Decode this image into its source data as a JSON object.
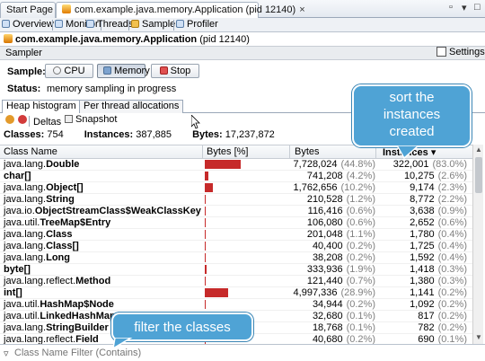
{
  "doc_tabs": [
    {
      "label": "Start Page",
      "active": false
    },
    {
      "label": "com.example.java.memory.Application (pid 12140)",
      "active": true
    }
  ],
  "sub_tabs": [
    {
      "label": "Overview",
      "icon": "overview-icon"
    },
    {
      "label": "Monitor",
      "icon": "monitor-icon"
    },
    {
      "label": "Threads",
      "icon": "threads-icon"
    },
    {
      "label": "Sampler",
      "icon": "sampler-icon",
      "active": true
    },
    {
      "label": "Profiler",
      "icon": "profiler-icon"
    }
  ],
  "app": {
    "name": "com.example.java.memory.Application",
    "pid": "(pid 12140)"
  },
  "section": {
    "title": "Sampler",
    "settings_label": "Settings"
  },
  "sample": {
    "label": "Sample:",
    "buttons": {
      "cpu": "CPU",
      "memory": "Memory",
      "stop": "Stop"
    }
  },
  "status": {
    "label": "Status:",
    "value": "memory sampling in progress"
  },
  "histogram_tabs": {
    "heap": "Heap histogram",
    "per_thread": "Per thread allocations"
  },
  "toolbar": {
    "deltas": "Deltas",
    "snapshot": "Snapshot"
  },
  "summary": {
    "classes_label": "Classes:",
    "classes_value": "754",
    "instances_label": "Instances:",
    "instances_value": "387,885",
    "bytes_label": "Bytes:",
    "bytes_value": "17,237,872"
  },
  "table": {
    "columns": {
      "class_name": "Class Name",
      "bytes_pct": "Bytes [%]",
      "bytes": "Bytes",
      "instances": "Instances"
    },
    "sort_indicator": "▾",
    "rows": [
      {
        "pkg": "java.lang.",
        "cls": "Double",
        "bytes_fraction": 0.448,
        "bytes": "7,728,024",
        "bytes_pct": "(44.8%)",
        "instances": "322,001",
        "inst_pct": "(83.0%)"
      },
      {
        "pkg": "",
        "cls": "char[]",
        "bytes_fraction": 0.042,
        "bytes": "741,208",
        "bytes_pct": "(4.2%)",
        "instances": "10,275",
        "inst_pct": "(2.6%)"
      },
      {
        "pkg": "java.lang.",
        "cls": "Object[]",
        "bytes_fraction": 0.102,
        "bytes": "1,762,656",
        "bytes_pct": "(10.2%)",
        "instances": "9,174",
        "inst_pct": "(2.3%)"
      },
      {
        "pkg": "java.lang.",
        "cls": "String",
        "bytes_fraction": 0.012,
        "bytes": "210,528",
        "bytes_pct": "(1.2%)",
        "instances": "8,772",
        "inst_pct": "(2.2%)"
      },
      {
        "pkg": "java.io.",
        "cls": "ObjectStreamClass$WeakClassKey",
        "bytes_fraction": 0.006,
        "bytes": "116,416",
        "bytes_pct": "(0.6%)",
        "instances": "3,638",
        "inst_pct": "(0.9%)"
      },
      {
        "pkg": "java.util.",
        "cls": "TreeMap$Entry",
        "bytes_fraction": 0.006,
        "bytes": "106,080",
        "bytes_pct": "(0.6%)",
        "instances": "2,652",
        "inst_pct": "(0.6%)"
      },
      {
        "pkg": "java.lang.",
        "cls": "Class",
        "bytes_fraction": 0.011,
        "bytes": "201,048",
        "bytes_pct": "(1.1%)",
        "instances": "1,780",
        "inst_pct": "(0.4%)"
      },
      {
        "pkg": "java.lang.",
        "cls": "Class[]",
        "bytes_fraction": 0.002,
        "bytes": "40,400",
        "bytes_pct": "(0.2%)",
        "instances": "1,725",
        "inst_pct": "(0.4%)"
      },
      {
        "pkg": "java.lang.",
        "cls": "Long",
        "bytes_fraction": 0.002,
        "bytes": "38,208",
        "bytes_pct": "(0.2%)",
        "instances": "1,592",
        "inst_pct": "(0.4%)"
      },
      {
        "pkg": "",
        "cls": "byte[]",
        "bytes_fraction": 0.019,
        "bytes": "333,936",
        "bytes_pct": "(1.9%)",
        "instances": "1,418",
        "inst_pct": "(0.3%)"
      },
      {
        "pkg": "java.lang.reflect.",
        "cls": "Method",
        "bytes_fraction": 0.007,
        "bytes": "121,440",
        "bytes_pct": "(0.7%)",
        "instances": "1,380",
        "inst_pct": "(0.3%)"
      },
      {
        "pkg": "",
        "cls": "int[]",
        "bytes_fraction": 0.289,
        "bytes": "4,997,336",
        "bytes_pct": "(28.9%)",
        "instances": "1,141",
        "inst_pct": "(0.2%)"
      },
      {
        "pkg": "java.util.",
        "cls": "HashMap$Node",
        "bytes_fraction": 0.002,
        "bytes": "34,944",
        "bytes_pct": "(0.2%)",
        "instances": "1,092",
        "inst_pct": "(0.2%)"
      },
      {
        "pkg": "java.util.",
        "cls": "LinkedHashMap$E",
        "bytes_fraction": 0.001,
        "bytes": "32,680",
        "bytes_pct": "(0.1%)",
        "instances": "817",
        "inst_pct": "(0.2%)"
      },
      {
        "pkg": "java.lang.",
        "cls": "StringBuilder",
        "bytes_fraction": 0.001,
        "bytes": "18,768",
        "bytes_pct": "(0.1%)",
        "instances": "782",
        "inst_pct": "(0.2%)"
      },
      {
        "pkg": "java.lang.reflect.",
        "cls": "Field",
        "bytes_fraction": 0.002,
        "bytes": "40,680",
        "bytes_pct": "(0.2%)",
        "instances": "690",
        "inst_pct": "(0.1%)"
      }
    ]
  },
  "filter": {
    "placeholder": "Class Name Filter (Contains)"
  },
  "callouts": {
    "sort": [
      "sort the",
      "instances",
      "created"
    ],
    "filter": "filter the classes"
  },
  "colors": {
    "bar": "#c62a2a",
    "callout": "#4fa3d5"
  }
}
